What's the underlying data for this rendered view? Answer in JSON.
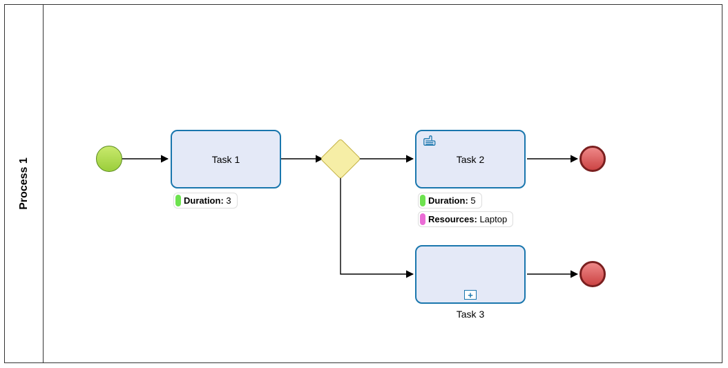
{
  "pool": {
    "title": "Process 1"
  },
  "tasks": {
    "t1": {
      "label": "Task 1"
    },
    "t2": {
      "label": "Task 2"
    },
    "t3": {
      "label": "Task 3"
    }
  },
  "badges": {
    "t1_duration": {
      "label": "Duration:",
      "value": "3"
    },
    "t2_duration": {
      "label": "Duration:",
      "value": "5"
    },
    "t2_resources": {
      "label": "Resources:",
      "value": "Laptop"
    }
  }
}
